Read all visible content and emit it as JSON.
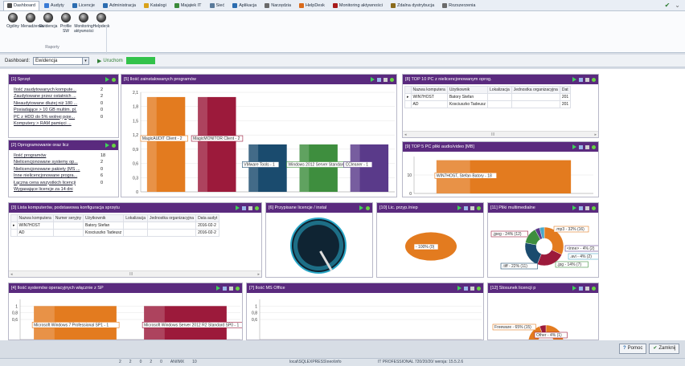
{
  "ribbon": {
    "tabs": [
      {
        "label": "Dashboard",
        "color": "#4a4a4a",
        "active": true
      },
      {
        "label": "Audyty",
        "color": "#3a7bd5"
      },
      {
        "label": "Licencje",
        "color": "#2b6cb0"
      },
      {
        "label": "Administracja",
        "color": "#2b6cb0"
      },
      {
        "label": "Katalogi",
        "color": "#d9a21b"
      },
      {
        "label": "Majątek IT",
        "color": "#3a8a3a"
      },
      {
        "label": "Sieć",
        "color": "#5a7a9a"
      },
      {
        "label": "Aplikacja",
        "color": "#2b6cb0"
      },
      {
        "label": "Narzędzia",
        "color": "#6a6a6a"
      },
      {
        "label": "HelpDesk",
        "color": "#d96a1b"
      },
      {
        "label": "Monitoring aktywności",
        "color": "#a81b1b"
      },
      {
        "label": "Zdalna dystrybucja",
        "color": "#8a6a1b"
      },
      {
        "label": "Rozszerzenia",
        "color": "#6a6a6a"
      }
    ],
    "buttons": [
      {
        "label": "Ogólny",
        "sub": ""
      },
      {
        "label": "Menadżerski",
        "sub": ""
      },
      {
        "label": "Ewidencja",
        "sub": ""
      },
      {
        "label": "Profile",
        "sub": "SW"
      },
      {
        "label": "Monitoring",
        "sub": "aktywności"
      },
      {
        "label": "Helpdesk",
        "sub": ""
      }
    ],
    "group_label": "Raporty",
    "right_check": "✔",
    "right_more": "⌄"
  },
  "toolbar": {
    "dashboard_label": "Dashboard:",
    "dashboard_value": "Ewidencja",
    "run_label": "Uruchom",
    "run_status_color": "#33c24a"
  },
  "panels": {
    "sprzet": {
      "title": "[1] Sprzęt",
      "items": [
        {
          "label": "Ilość zaudytowanych kompute...",
          "value": "2"
        },
        {
          "label": "Zaudytowane przez ostatnich ...",
          "value": "2"
        },
        {
          "label": "Nieaudytowane dłużej niż 180 ...",
          "value": "0"
        },
        {
          "label": "Posiadające > 10 GB multim. pl.",
          "value": "0"
        },
        {
          "label": "PC z HDD do 5% wolnej poje...",
          "value": "0"
        },
        {
          "label": "Komputery > RAM pamięci ...",
          "value": ""
        }
      ]
    },
    "oprogramowanie": {
      "title": "[2] Oprogramowanie oraz licz",
      "items": [
        {
          "label": "Ilość programów",
          "value": "18"
        },
        {
          "label": "Nielicencjonowane systemy op...",
          "value": "2"
        },
        {
          "label": "Nielicencjonowane pakiety (MS ...",
          "value": "0"
        },
        {
          "label": "Inne nielicencjonowane progra...",
          "value": "6"
        },
        {
          "label": "Łączna cena wszystkich licencji",
          "value": "0"
        },
        {
          "label": "Wygasające licencje za 14 dni",
          "value": ""
        }
      ]
    },
    "programs": {
      "title": "[5] Ilość zainstalowanych programów"
    },
    "top10": {
      "title": "[8] TOP 10 PC z nielicencjonowanym oprog.",
      "columns": [
        "Nazwa komputera",
        "Użytkownik",
        "Lokalizacja",
        "Jednostka organizacyjna",
        "Dat"
      ],
      "rows": [
        [
          "WIN7HOST",
          "Batory Stefan",
          "",
          "",
          "201"
        ],
        [
          "AD",
          "Kosciuszko Tadeusz",
          "",
          "",
          "201"
        ]
      ],
      "scroll": "III"
    },
    "top5": {
      "title": "[9] TOP 5 PC pliki audio/video [MB]"
    },
    "lista": {
      "title": "[3] Lista komputerów, podstawowa konfiguracja sprzętu",
      "columns": [
        "Nazwa komputera",
        "Numer seryjny",
        "Użytkownik",
        "Lokalizacja",
        "Jednostka organizacyjna",
        "Data audyt"
      ],
      "rows": [
        [
          "WIN7HOST",
          "",
          "Batory Stefan",
          "",
          "",
          "2016-02-2"
        ],
        [
          "AD",
          "",
          "Kosciuszko Tadeusz",
          "",
          "",
          "2016-02-2"
        ]
      ],
      "scroll": "III"
    },
    "przypisane": {
      "title": "[6] Przypisane licencje / instal"
    },
    "licprzyp": {
      "title": "[10] Lic. przyp./niep"
    },
    "multimedia": {
      "title": "[11] Pliki multimedialne"
    },
    "systemy": {
      "title": "[4] Ilość systemów operacyjnych włącznie z SP"
    },
    "msoffice": {
      "title": "[7] Ilość MS Office"
    },
    "stosunek": {
      "title": "[12] Stosunek licencji p"
    }
  },
  "chart_data": [
    {
      "type": "bar",
      "title": "[5] Ilość zainstalowanych programów",
      "categories": [
        "MagicAUDIT Client",
        "MagicMONITOR Client",
        "VMware Tools",
        "Windows 2012 Server Standard",
        "CCleaner"
      ],
      "values": [
        2,
        2,
        1,
        1,
        1
      ],
      "data_labels": [
        "MagicAUDIT Client - 2",
        "MagicMONITOR Client - 2",
        "VMware Tools - 1",
        "Windows 2012 Server Standard - 1",
        "CCleaner - 1"
      ],
      "colors": [
        "#e37b1f",
        "#9c1a3b",
        "#1a4b6e",
        "#3e8e3e",
        "#5a3a8a"
      ],
      "ylim": [
        0,
        2.1
      ],
      "yticks": [
        "0",
        "0,3",
        "0,6",
        "0,9",
        "1,2",
        "1,5",
        "1,8",
        "2,1"
      ]
    },
    {
      "type": "bar",
      "title": "[9] TOP 5 PC pliki audio/video [MB]",
      "categories": [
        "WIN7HOST, Stefan Batory"
      ],
      "values": [
        18
      ],
      "data_labels": [
        "WIN7HOST, Stefan Batory - 18"
      ],
      "colors": [
        "#e37b1f"
      ],
      "ylim": [
        0,
        20
      ],
      "yticks": [
        "0",
        "10"
      ]
    },
    {
      "type": "pie",
      "title": "[10] Lic. przyp./niep",
      "slices": [
        {
          "label": "- 100% (0)",
          "value": 100
        }
      ],
      "colors": [
        "#e37b1f"
      ]
    },
    {
      "type": "pie",
      "title": "[11] Pliki multimedialne",
      "slices": [
        {
          "label": ".mp3 - 32% (16)",
          "value": 32
        },
        {
          "label": ".jpeg - 24% (12)",
          "value": 24
        },
        {
          "label": ".tiff - 22% (11)",
          "value": 22
        },
        {
          "label": ".jpg - 14% (7)",
          "value": 14
        },
        {
          "label": "<inne> - 4% (2)",
          "value": 4
        },
        {
          "label": ".avi - 4% (2)",
          "value": 4
        }
      ],
      "colors": [
        "#e37b1f",
        "#9c1a3b",
        "#1a4b6e",
        "#3e8e3e",
        "#5a3a8a",
        "#4aa8c8"
      ]
    },
    {
      "type": "bar",
      "title": "[4] Ilość systemów operacyjnych włącznie z SP",
      "categories": [
        "Microsoft Windows 7 Professional SP1",
        "Microsoft Windows Server 2012 R2 Standard SP0"
      ],
      "values": [
        1,
        1
      ],
      "data_labels": [
        "Microsoft Windows 7 Professional SP1 - 1",
        "Microsoft Windows Server 2012 R2 Standard SP0 - 1"
      ],
      "colors": [
        "#e37b1f",
        "#9c1a3b"
      ],
      "ylim": [
        0,
        1.2
      ],
      "yticks": [
        "0,6",
        "0,8",
        "1"
      ]
    },
    {
      "type": "bar",
      "title": "[7] Ilość MS Office",
      "categories": [],
      "values": [],
      "ylim": [
        0,
        1.2
      ],
      "yticks": [
        "0,6",
        "0,8",
        "1"
      ]
    },
    {
      "type": "pie",
      "title": "[12] Stosunek licencji p",
      "slices": [
        {
          "label": "Freeware - 65% (15)",
          "value": 65
        },
        {
          "label": "Other - 4% (1)",
          "value": 4
        }
      ],
      "colors": [
        "#e37b1f",
        "#9c1a3b"
      ]
    }
  ],
  "bottom_buttons": {
    "help": "Pomoc",
    "close": "Zamknij"
  },
  "statusbar": {
    "counts": [
      "2",
      "2",
      "0",
      "2",
      "0",
      "AN/IMX",
      "10"
    ],
    "db": "local\\SQLEXPRESS\\neo\\info",
    "version": "IT PROFESSIONAL 720/20/20/ wersja: 15.5.2.6"
  }
}
